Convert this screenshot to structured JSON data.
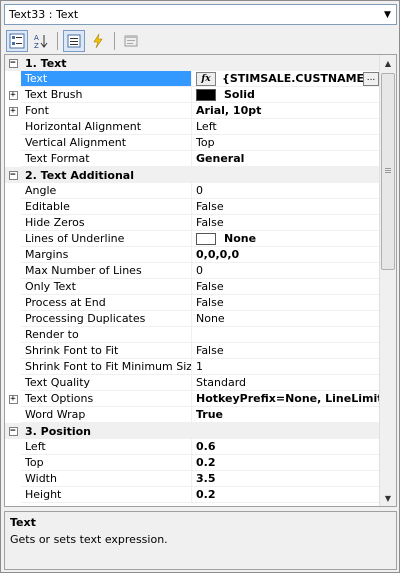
{
  "selector": {
    "value": "Text33 : Text",
    "arrow_icon": "chevron-down-icon"
  },
  "toolbar": {
    "buttons": [
      {
        "name": "categorized-button",
        "icon": "categorized-icon"
      },
      {
        "name": "alphabetical-button",
        "icon": "sort-az-icon"
      },
      {
        "name": "properties-button",
        "icon": "properties-icon"
      },
      {
        "name": "events-button",
        "icon": "lightning-icon"
      },
      {
        "name": "property-pages-button",
        "icon": "property-pages-icon"
      }
    ]
  },
  "grid": {
    "categories": {
      "c1": "1. Text",
      "c2": "2. Text  Additional",
      "c3": "3. Position"
    },
    "rows": {
      "text": {
        "name": "Text",
        "value": "{STIMSALE.CUSTNAME}",
        "fx": "fx",
        "ellipsis": "..."
      },
      "text_brush": {
        "name": "Text Brush",
        "value": "Solid",
        "color": "#000000"
      },
      "font": {
        "name": "Font",
        "value": "Arial, 10pt"
      },
      "horizontal_alignment": {
        "name": "Horizontal Alignment",
        "value": "Left"
      },
      "vertical_alignment": {
        "name": "Vertical Alignment",
        "value": "Top"
      },
      "text_format": {
        "name": "Text Format",
        "value": "General"
      },
      "angle": {
        "name": "Angle",
        "value": "0"
      },
      "editable": {
        "name": "Editable",
        "value": "False"
      },
      "hide_zeros": {
        "name": "Hide Zeros",
        "value": "False"
      },
      "lines_of_underline": {
        "name": "Lines of Underline",
        "value": "None",
        "color": "#ffffff"
      },
      "margins": {
        "name": "Margins",
        "value": "0,0,0,0"
      },
      "max_number_of_lines": {
        "name": "Max Number of Lines",
        "value": "0"
      },
      "only_text": {
        "name": "Only Text",
        "value": "False"
      },
      "process_at_end": {
        "name": "Process at End",
        "value": "False"
      },
      "processing_duplicates": {
        "name": "Processing Duplicates",
        "value": "None"
      },
      "render_to": {
        "name": "Render to",
        "value": ""
      },
      "shrink_font_to_fit": {
        "name": "Shrink Font to Fit",
        "value": "False"
      },
      "shrink_font_to_fit_minimum_size": {
        "name": "Shrink Font to Fit Minimum Size",
        "value": "1"
      },
      "text_quality": {
        "name": "Text Quality",
        "value": "Standard"
      },
      "text_options": {
        "name": "Text Options",
        "value": "HotkeyPrefix=None, LineLimit=Fal"
      },
      "word_wrap": {
        "name": "Word Wrap",
        "value": "True"
      },
      "left": {
        "name": "Left",
        "value": "0.6"
      },
      "top": {
        "name": "Top",
        "value": "0.2"
      },
      "width": {
        "name": "Width",
        "value": "3.5"
      },
      "height": {
        "name": "Height",
        "value": "0.2"
      }
    }
  },
  "description": {
    "title": "Text",
    "text": "Gets or sets text expression."
  },
  "colors": {
    "selection": "#3399ff",
    "category_bg": "#f0f0f0"
  }
}
